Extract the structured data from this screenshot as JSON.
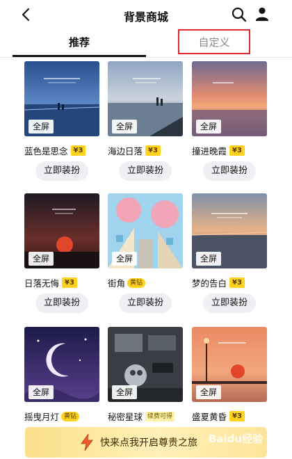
{
  "header": {
    "title": "背景商城"
  },
  "tabs": [
    {
      "label": "推荐"
    },
    {
      "label": "自定义"
    }
  ],
  "labels": {
    "fullscreen": "全屏",
    "apply": "立即装扮"
  },
  "items": [
    {
      "name": "蓝色是思念",
      "price": "¥3"
    },
    {
      "name": "海边日落",
      "price": "¥3"
    },
    {
      "name": "撞进晚霞",
      "price": "¥3"
    },
    {
      "name": "日落无悔",
      "price": "¥3"
    },
    {
      "name": "街角",
      "badge": "黄钻"
    },
    {
      "name": "梦的告白",
      "price": "¥3"
    },
    {
      "name": "摇曳月灯",
      "badge": "黄钻"
    },
    {
      "name": "秘密星球",
      "badge": "续费可得"
    },
    {
      "name": "盛夏黄昏",
      "price": "¥3"
    }
  ],
  "vip_banner": {
    "text": "快来点我开启尊贵之旅"
  },
  "watermark": "Baidu经验",
  "colors": {
    "accent_yellow": "#ffd21e",
    "highlight_box": "#e0292c",
    "button_bg": "#eef0f4"
  }
}
